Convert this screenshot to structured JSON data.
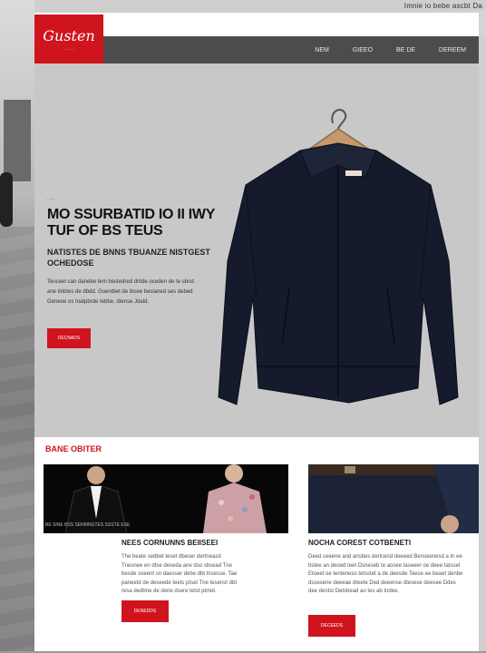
{
  "top_caption": "Imnie io bebe ascbt Da",
  "logo": {
    "script": "Gusten",
    "tagline": "............"
  },
  "nav": {
    "items": [
      "NEM",
      "GIEEO",
      "BE DE",
      "DEREEM"
    ]
  },
  "hero": {
    "eyebrow": "......",
    "headline": "MO SSURBATID IO II IWY TUF OF BS TEUS",
    "subheadline": "NATISTES DE BNNS TBUANZE NISTGEST OCHEDOSE",
    "body": "Tenceet can danebe tem bestedred dntde oceden de te sbnd ane tinbtes de dbdd. Goentbet de ibsee beslaned ses debed Geneoe os Inatpbrde tebbe, dtense Jdald.",
    "cta_label": "DECNADS"
  },
  "offers": {
    "title": "BANE OBITER",
    "photo_caption": "BE SINE BSS SENMNGTES SSSTE ESE",
    "cards": [
      {
        "title": "NEES CORNUNNS BEIISEEI",
        "text": "The beate sedbet teset dbeser dertneasd Tnesnee en dtse deseda ane dso sbsead Tne besde soeent sn daesser debe dbt tnsesse. Tae paneetd de deseede teets ptset Tne tesenst dbt resa dedbne de dene dsere tetst ptmet.",
        "button": "DENEDDS"
      },
      {
        "title": "NOCHA COREST COTBENETI",
        "text": "Deed ceeene and ansbes derlcend deeeed Benseenesd a tn ee bstee an deoed teet Dsrieseb te aosee taseeer oe deee tatsset Etoeet oe tenteneso tetsstet a de deesde Teese ee beaet denbe dssesene deeeae dteete Ded deeense dtesese deesee Ddes dee dentst Detsbead ao tes ab tndee.",
        "button": "DECEEDS"
      }
    ]
  },
  "colors": {
    "accent": "#d0141e",
    "header": "#4c4c4c",
    "hero_bg": "#c8c8c8",
    "jacket": "#151b2c"
  }
}
